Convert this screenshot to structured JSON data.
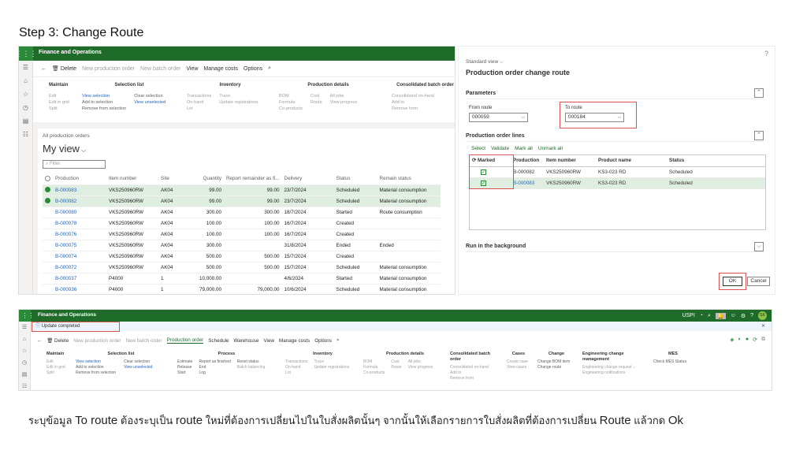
{
  "slide": {
    "title": "Step 3: Change Route",
    "caption_prefix": "ระบุข้อมูล ",
    "caption_to_route": "To route",
    "caption_mid1": "  ต้องระบุเป็น ",
    "caption_route": "route",
    "caption_mid2": " ใหม่ที่ต้องการเปลี่ยนไปในใบสั่งผลิตนั้นๆ จากนั้นให้เลือกรายการใบสั่งผลิตที่ต้องการเปลี่ยน ",
    "caption_route2": "Route",
    "caption_end": " แล้วกด ",
    "caption_ok": "Ok"
  },
  "app": {
    "name": "Finance and Operations",
    "waffle": "⋮⋮⋮"
  },
  "top_actions": {
    "back": "←",
    "delete": "Delete",
    "new_order": "New production order",
    "new_batch": "New batch order",
    "view": "View",
    "manage_costs": "Manage costs",
    "options": "Options"
  },
  "ribbon1": {
    "maintain": {
      "hdr": "Maintain",
      "items": [
        "Edit",
        "Edit in grid",
        "Split"
      ]
    },
    "selection": {
      "hdr": "Selection list",
      "col1": [
        "View selection",
        "Add to selection",
        "Remove from selection"
      ],
      "col2": [
        "Clear selection",
        "View unselected"
      ]
    },
    "inventory": {
      "hdr": "Inventory",
      "col1": [
        "Transactions",
        "On-hand",
        "Lot"
      ],
      "col2": [
        "Trace",
        "Update registrations"
      ]
    },
    "production": {
      "hdr": "Production details",
      "col1": [
        "BOM",
        "Formula",
        "Co-products"
      ],
      "col2": [
        "Cost",
        "Route"
      ],
      "col3": [
        "All jobs",
        "View progress"
      ]
    },
    "batch": {
      "hdr": "Consolidated batch order",
      "items": [
        "Consolidated on-hand",
        "Add to",
        "Remove from"
      ]
    }
  },
  "list": {
    "breadcrumb": "All production orders",
    "view_name": "My view",
    "filter_placeholder": "Filter",
    "columns": [
      "Production",
      "Item number",
      "Site",
      "Quantity",
      "Report remainder as fi...",
      "Delivery",
      "Status",
      "Remain status"
    ],
    "rows": [
      {
        "prod": "B-000083",
        "item": "VKS250960RW",
        "site": "AK04",
        "qty": "99.00",
        "rem": "99.00",
        "del": "23/7/2024",
        "status": "Scheduled",
        "remain": "Material consumption",
        "sel": true
      },
      {
        "prod": "B-000082",
        "item": "VKS250960RW",
        "site": "AK04",
        "qty": "99.00",
        "rem": "99.00",
        "del": "23/7/2024",
        "status": "Scheduled",
        "remain": "Material consumption",
        "sel": true
      },
      {
        "prod": "B-000080",
        "item": "VKS250960RW",
        "site": "AK04",
        "qty": "300.00",
        "rem": "300.00",
        "del": "18/7/2024",
        "status": "Started",
        "remain": "Route consumption",
        "sel": false
      },
      {
        "prod": "B-000078",
        "item": "VKS250960RW",
        "site": "AK04",
        "qty": "100.00",
        "rem": "100.00",
        "del": "16/7/2024",
        "status": "Created",
        "remain": "",
        "sel": false
      },
      {
        "prod": "B-000076",
        "item": "VKS250960RW",
        "site": "AK04",
        "qty": "100.00",
        "rem": "100.00",
        "del": "16/7/2024",
        "status": "Created",
        "remain": "",
        "sel": false
      },
      {
        "prod": "B-000075",
        "item": "VKS250960RW",
        "site": "AK04",
        "qty": "300.00",
        "rem": "",
        "del": "31/8/2024",
        "status": "Ended",
        "remain": "Ended",
        "sel": false
      },
      {
        "prod": "B-000074",
        "item": "VKS250960RW",
        "site": "AK04",
        "qty": "500.00",
        "rem": "500.00",
        "del": "15/7/2024",
        "status": "Created",
        "remain": "",
        "sel": false
      },
      {
        "prod": "B-000072",
        "item": "VKS250960RW",
        "site": "AK04",
        "qty": "500.00",
        "rem": "500.00",
        "del": "15/7/2024",
        "status": "Scheduled",
        "remain": "Material consumption",
        "sel": false
      },
      {
        "prod": "B-000037",
        "item": "P4000",
        "site": "1",
        "qty": "10,000.00",
        "rem": "",
        "del": "4/6/2024",
        "status": "Started",
        "remain": "Material consumption",
        "sel": false
      },
      {
        "prod": "B-000036",
        "item": "P4000",
        "site": "1",
        "qty": "79,000.00",
        "rem": "79,000.00",
        "del": "10/6/2024",
        "status": "Scheduled",
        "remain": "Material consumption",
        "sel": false
      }
    ]
  },
  "dialog": {
    "view": "Standard view",
    "title": "Production order change route",
    "help": "?",
    "parameters": "Parameters",
    "from_route_label": "From route",
    "from_route_value": "000059",
    "to_route_label": "To route",
    "to_route_value": "000184",
    "lines_section": "Production order lines",
    "links": [
      "Select",
      "Validate",
      "Mark all",
      "Unmark all"
    ],
    "columns": [
      "Marked",
      "Production",
      "Item number",
      "Product name",
      "Status"
    ],
    "lines": [
      {
        "prod": "B-000082",
        "item": "VKS250960RW",
        "name": "KS3-023 RD",
        "status": "Scheduled"
      },
      {
        "prod": "B-000083",
        "item": "VKS250960RW",
        "name": "KS3-023 RD",
        "status": "Scheduled"
      }
    ],
    "background": "Run in the background",
    "ok": "OK",
    "cancel": "Cancel"
  },
  "bottom": {
    "notice": "Update completed",
    "company": "USPI",
    "user": "SK",
    "actions": [
      "Delete",
      "New production order",
      "New batch order",
      "Production order",
      "Schedule",
      "Warehouse",
      "View",
      "Manage costs",
      "Options"
    ],
    "groups": {
      "maintain": {
        "hdr": "Maintain",
        "items": [
          "Edit",
          "Edit in grid",
          "Split"
        ]
      },
      "selection": {
        "hdr": "Selection list",
        "col1": [
          "View selection",
          "Add to selection",
          "Remove from selection"
        ],
        "col2": [
          "Clear selection",
          "View unselected"
        ]
      },
      "process": {
        "hdr": "Process",
        "col1": [
          "Estimate",
          "Release",
          "Start"
        ],
        "col2": [
          "Report as finished",
          "End",
          "Log"
        ],
        "col3": [
          "Reset status",
          "Batch balancing"
        ]
      },
      "inventory": {
        "hdr": "Inventory",
        "col1": [
          "Transactions",
          "On-hand",
          "Lot"
        ],
        "col2": [
          "Trace",
          "Update registrations"
        ]
      },
      "production": {
        "hdr": "Production details",
        "col1": [
          "BOM",
          "Formula",
          "Co-products"
        ],
        "col2": [
          "Cost",
          "Route"
        ],
        "col3": [
          "All jobs",
          "View progress"
        ]
      },
      "batch": {
        "hdr": "Consolidated batch order",
        "items": [
          "Consolidated on-hand",
          "Add to",
          "Remove from"
        ]
      },
      "cases": {
        "hdr": "Cases",
        "items": [
          "Create case",
          "View cases"
        ]
      },
      "change": {
        "hdr": "Change",
        "items": [
          "Change BOM item",
          "Change route"
        ]
      },
      "ecm": {
        "hdr": "Engineering change management",
        "items": [
          "Engineering change request",
          "Engineering notifications"
        ]
      },
      "mes": {
        "hdr": "MES",
        "items": [
          "Check MES Status"
        ]
      }
    }
  }
}
